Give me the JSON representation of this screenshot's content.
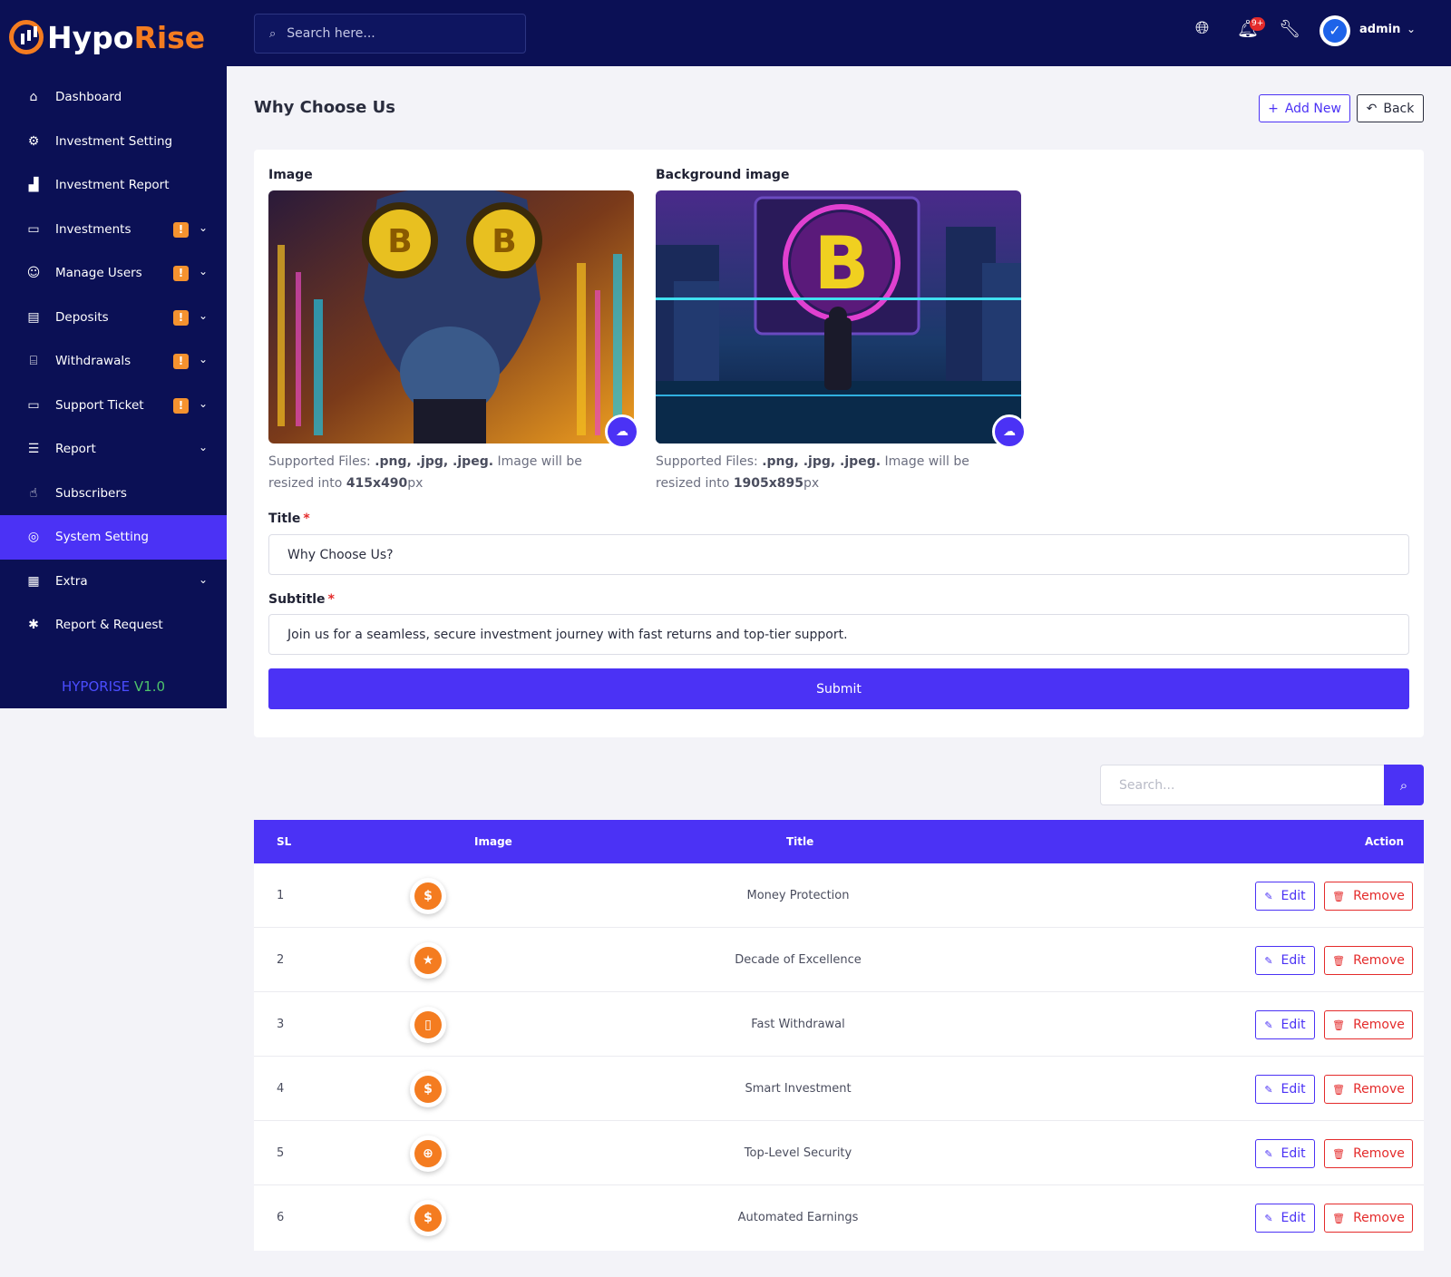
{
  "brand": {
    "name_part1": "Hypo",
    "name_part2": "Rise",
    "accent_color": "#f47c20",
    "primary_color": "#4b32f5",
    "sidebar_color": "#0b1055"
  },
  "sidebar": {
    "items": [
      {
        "label": "Dashboard",
        "icon": "home-icon",
        "glyph": "⌂",
        "badge": false,
        "chevron": false,
        "active": false
      },
      {
        "label": "Investment Setting",
        "icon": "nodes-icon",
        "glyph": "⚙",
        "badge": false,
        "chevron": false,
        "active": false
      },
      {
        "label": "Investment Report",
        "icon": "bar-chart-icon",
        "glyph": "▟",
        "badge": false,
        "chevron": false,
        "active": false
      },
      {
        "label": "Investments",
        "icon": "wallet-icon",
        "glyph": "▭",
        "badge": true,
        "chevron": true,
        "active": false
      },
      {
        "label": "Manage Users",
        "icon": "users-icon",
        "glyph": "☺",
        "badge": true,
        "chevron": true,
        "active": false
      },
      {
        "label": "Deposits",
        "icon": "document-icon",
        "glyph": "▤",
        "badge": true,
        "chevron": true,
        "active": false
      },
      {
        "label": "Withdrawals",
        "icon": "bank-icon",
        "glyph": "⌸",
        "badge": true,
        "chevron": true,
        "active": false
      },
      {
        "label": "Support Ticket",
        "icon": "ticket-icon",
        "glyph": "▭",
        "badge": true,
        "chevron": true,
        "active": false
      },
      {
        "label": "Report",
        "icon": "list-icon",
        "glyph": "☰",
        "badge": false,
        "chevron": true,
        "active": false
      },
      {
        "label": "Subscribers",
        "icon": "thumbs-up-icon",
        "glyph": "☝",
        "badge": false,
        "chevron": false,
        "active": false
      },
      {
        "label": "System Setting",
        "icon": "settings-icon",
        "glyph": "◎",
        "badge": false,
        "chevron": false,
        "active": true
      },
      {
        "label": "Extra",
        "icon": "table-icon",
        "glyph": "▦",
        "badge": false,
        "chevron": true,
        "active": false
      },
      {
        "label": "Report & Request",
        "icon": "bug-icon",
        "glyph": "✱",
        "badge": false,
        "chevron": false,
        "active": false
      }
    ],
    "badge_text": "!",
    "version_name": "HYPORISE",
    "version_number": "V1.0"
  },
  "topbar": {
    "search_placeholder": "Search here...",
    "notification_count": "9+",
    "user_name": "admin"
  },
  "page": {
    "title": "Why Choose Us",
    "add_new_label": "Add New",
    "back_label": "Back"
  },
  "form": {
    "image_label": "Image",
    "background_label": "Background image",
    "image_hint": {
      "prefix": "Supported Files: ",
      "types": ".png, .jpg, .jpeg.",
      "middle": " Image will be resized into ",
      "size": "415x490",
      "unit": "px"
    },
    "background_hint": {
      "prefix": "Supported Files: ",
      "types": ".png, .jpg, .jpeg.",
      "middle": " Image will be resized into ",
      "size": "1905x895",
      "unit": "px"
    },
    "title_label": "Title",
    "title_value": "Why Choose Us?",
    "subtitle_label": "Subtitle",
    "subtitle_value": "Join us for a seamless, secure investment journey with fast returns and top-tier support.",
    "submit_label": "Submit",
    "required_mark": "*"
  },
  "table": {
    "search_placeholder": "Search...",
    "headers": {
      "sl": "SL",
      "image": "Image",
      "title": "Title",
      "action": "Action"
    },
    "edit_label": "Edit",
    "remove_label": "Remove",
    "rows": [
      {
        "sl": "1",
        "title": "Money Protection",
        "icon": "shield-dollar-icon",
        "glyph": "$"
      },
      {
        "sl": "2",
        "title": "Decade of Excellence",
        "icon": "star-user-icon",
        "glyph": "★"
      },
      {
        "sl": "3",
        "title": "Fast Withdrawal",
        "icon": "cash-icon",
        "glyph": "▯"
      },
      {
        "sl": "4",
        "title": "Smart Investment",
        "icon": "money-bag-chart-icon",
        "glyph": "$"
      },
      {
        "sl": "5",
        "title": "Top-Level Security",
        "icon": "globe-shield-icon",
        "glyph": "⊕"
      },
      {
        "sl": "6",
        "title": "Automated Earnings",
        "icon": "hand-coin-icon",
        "glyph": "$"
      }
    ]
  }
}
